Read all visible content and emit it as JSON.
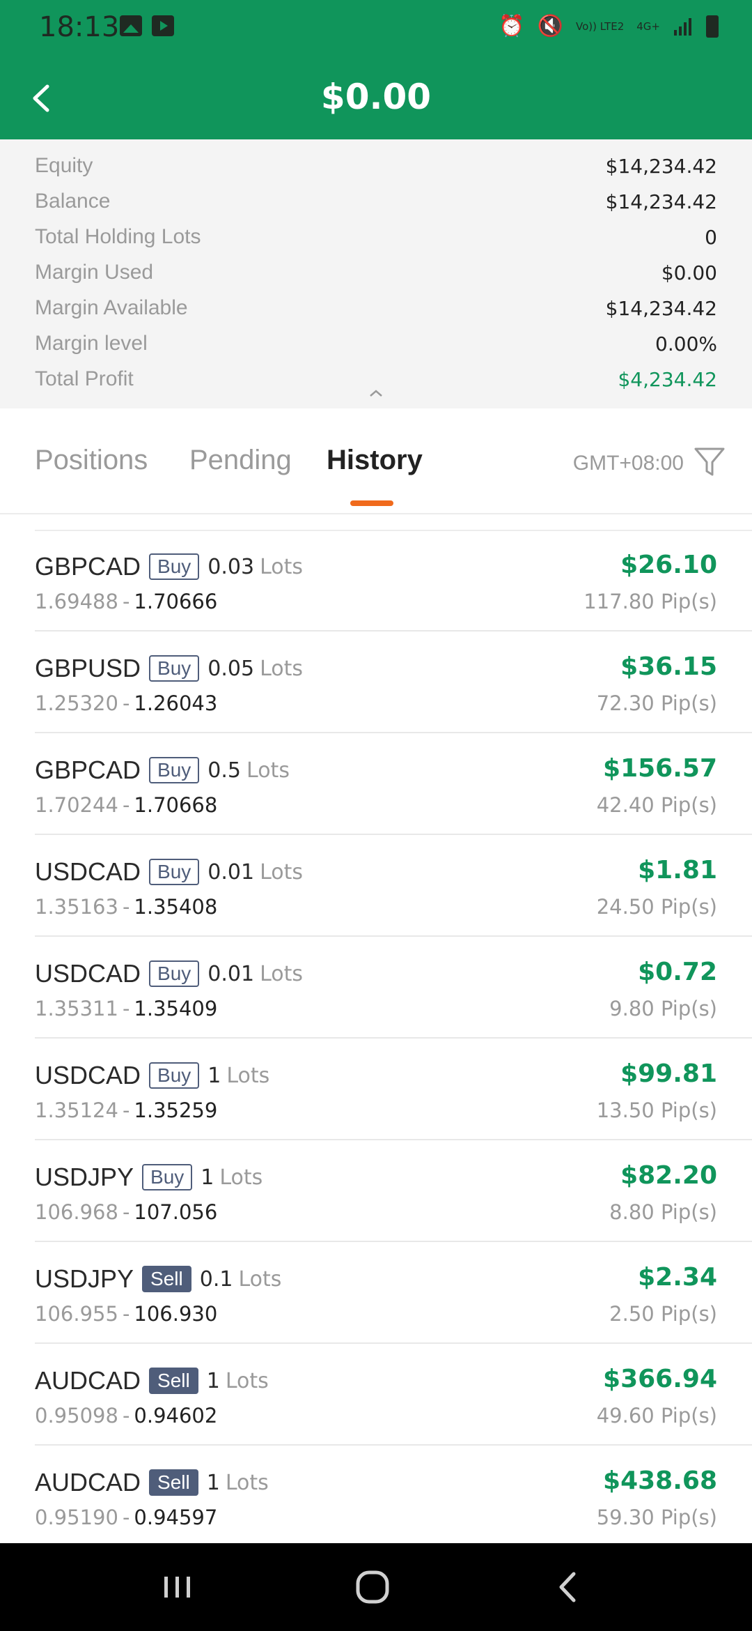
{
  "status_bar": {
    "time": "18:13",
    "left_icons": [
      "gallery-icon",
      "youtube-icon"
    ],
    "right_icons": [
      "alarm-icon",
      "mute-icon",
      "volte-icon",
      "4g-icon",
      "signal-icon",
      "battery-icon"
    ],
    "volte_label": "Vo)) LTE2",
    "network_label": "4G+"
  },
  "header": {
    "title": "$0.00"
  },
  "summary": {
    "rows": [
      {
        "label": "Equity",
        "value": "$14,234.42"
      },
      {
        "label": "Balance",
        "value": "$14,234.42"
      },
      {
        "label": "Total Holding Lots",
        "value": "0"
      },
      {
        "label": "Margin Used",
        "value": "$0.00"
      },
      {
        "label": "Margin Available",
        "value": "$14,234.42"
      },
      {
        "label": "Margin level",
        "value": "0.00%"
      },
      {
        "label": "Total Profit",
        "value": "$4,234.42"
      }
    ]
  },
  "tabs": {
    "positions": "Positions",
    "pending": "Pending",
    "history": "History",
    "active": "History",
    "timezone": "GMT+08:00"
  },
  "trades": [
    {
      "symbol": "GBPCAD",
      "side": "Buy",
      "lots": "0.03",
      "unit": "Lots",
      "open": "1.69488",
      "close": "1.70666",
      "profit": "$26.10",
      "pips": "117.80 Pip(s)"
    },
    {
      "symbol": "GBPUSD",
      "side": "Buy",
      "lots": "0.05",
      "unit": "Lots",
      "open": "1.25320",
      "close": "1.26043",
      "profit": "$36.15",
      "pips": "72.30 Pip(s)"
    },
    {
      "symbol": "GBPCAD",
      "side": "Buy",
      "lots": "0.5",
      "unit": "Lots",
      "open": "1.70244",
      "close": "1.70668",
      "profit": "$156.57",
      "pips": "42.40 Pip(s)"
    },
    {
      "symbol": "USDCAD",
      "side": "Buy",
      "lots": "0.01",
      "unit": "Lots",
      "open": "1.35163",
      "close": "1.35408",
      "profit": "$1.81",
      "pips": "24.50 Pip(s)"
    },
    {
      "symbol": "USDCAD",
      "side": "Buy",
      "lots": "0.01",
      "unit": "Lots",
      "open": "1.35311",
      "close": "1.35409",
      "profit": "$0.72",
      "pips": "9.80 Pip(s)"
    },
    {
      "symbol": "USDCAD",
      "side": "Buy",
      "lots": "1",
      "unit": "Lots",
      "open": "1.35124",
      "close": "1.35259",
      "profit": "$99.81",
      "pips": "13.50 Pip(s)"
    },
    {
      "symbol": "USDJPY",
      "side": "Buy",
      "lots": "1",
      "unit": "Lots",
      "open": "106.968",
      "close": "107.056",
      "profit": "$82.20",
      "pips": "8.80 Pip(s)"
    },
    {
      "symbol": "USDJPY",
      "side": "Sell",
      "lots": "0.1",
      "unit": "Lots",
      "open": "106.955",
      "close": "106.930",
      "profit": "$2.34",
      "pips": "2.50 Pip(s)"
    },
    {
      "symbol": "AUDCAD",
      "side": "Sell",
      "lots": "1",
      "unit": "Lots",
      "open": "0.95098",
      "close": "0.94602",
      "profit": "$366.94",
      "pips": "49.60 Pip(s)"
    },
    {
      "symbol": "AUDCAD",
      "side": "Sell",
      "lots": "1",
      "unit": "Lots",
      "open": "0.95190",
      "close": "0.94597",
      "profit": "$438.68",
      "pips": "59.30 Pip(s)"
    }
  ],
  "nav_bar": {
    "buttons": [
      "recent-apps-icon",
      "home-icon",
      "back-icon"
    ]
  },
  "colors": {
    "brand_green": "#10955b",
    "tab_indicator": "#f06a1c",
    "badge": "#4f5d7a"
  }
}
